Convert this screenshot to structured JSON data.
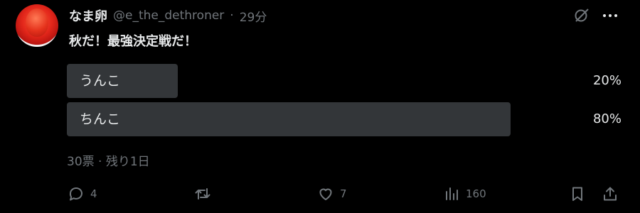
{
  "post": {
    "display_name": "なま卵",
    "handle": "@e_the_dethroner",
    "separator": "·",
    "time": "29分",
    "text": "秋だ！最強決定戦だ！"
  },
  "poll": {
    "options": [
      {
        "label": "うんこ",
        "percent_text": "20%",
        "fraction": 0.2
      },
      {
        "label": "ちんこ",
        "percent_text": "80%",
        "fraction": 0.8
      }
    ],
    "meta": "30票 · 残り1日",
    "bar_color": "#333639"
  },
  "actions": {
    "replies": "4",
    "reposts": "",
    "likes": "7",
    "views": "160"
  },
  "icons": [
    "grok-icon",
    "more-icon",
    "reply-icon",
    "repost-icon",
    "like-icon",
    "views-icon",
    "bookmark-icon",
    "share-icon"
  ],
  "colors": {
    "background": "#000000",
    "text": "#e7e9ea",
    "muted": "#71767b"
  }
}
